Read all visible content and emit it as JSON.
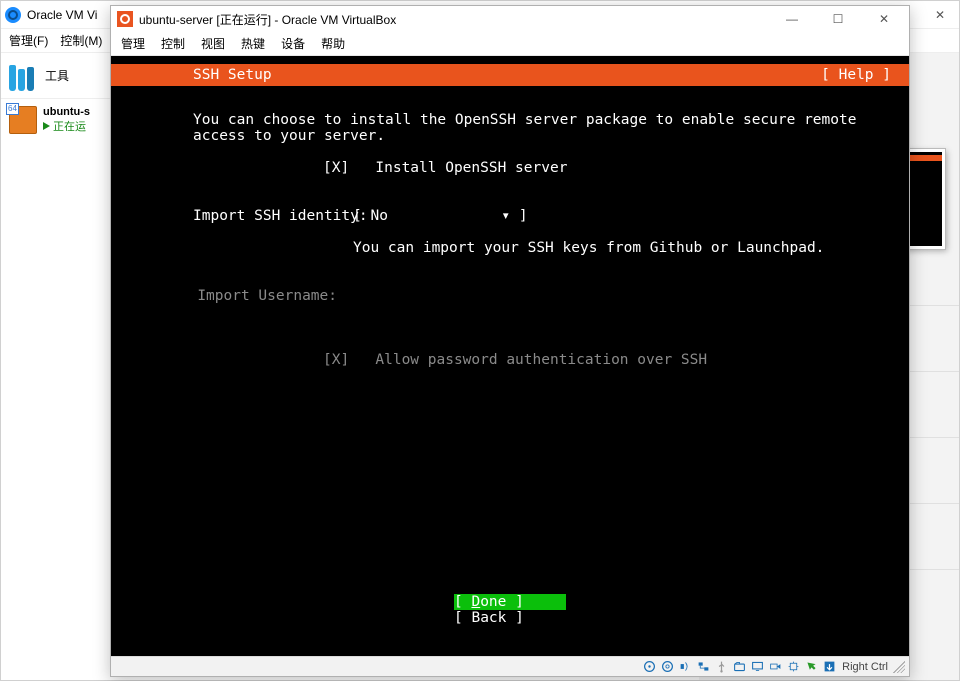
{
  "outer": {
    "title": "Oracle VM Vi",
    "menu": {
      "manage": "管理(F)",
      "control": "控制(M)"
    },
    "tools_label": "工具",
    "vm": {
      "name": "ubuntu-s",
      "state": "正在运"
    },
    "close_glyph": "✕"
  },
  "vm_window": {
    "title": "ubuntu-server [正在运行] - Oracle VM VirtualBox",
    "menu": {
      "manage": "管理",
      "control": "控制",
      "view": "视图",
      "hotkeys": "热键",
      "devices": "设备",
      "help": "帮助"
    },
    "min_glyph": "—",
    "max_glyph": "☐",
    "close_glyph": "✕"
  },
  "installer": {
    "title": "SSH Setup",
    "help": "[ Help ]",
    "desc1": "You can choose to install the OpenSSH server package to enable secure remote",
    "desc2": "access to your server.",
    "install_checkbox": "[X]   Install OpenSSH server",
    "import_label": "Import SSH identity:",
    "import_value": "[ No             ",
    "import_arrow": "▾",
    "import_close": " ]",
    "import_hint": "You can import your SSH keys from Github or Launchpad.",
    "username_label": "Import Username:",
    "allow_pw": "[X]   Allow password authentication over SSH",
    "done_open": "[ ",
    "done_letter": "D",
    "done_rest": "one       ",
    "done_close": "]",
    "back_open": "[ ",
    "back_label": "Back       ",
    "back_close": "]"
  },
  "statusbar": {
    "hostkey": "Right Ctrl"
  }
}
